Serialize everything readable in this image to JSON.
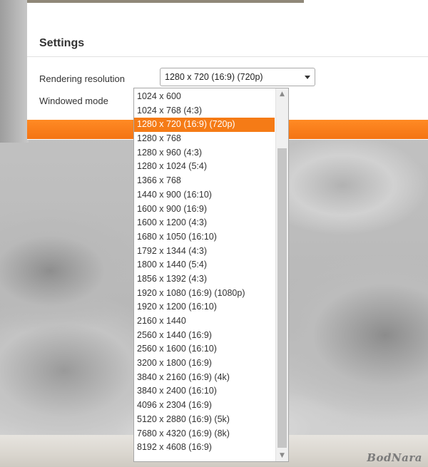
{
  "settings": {
    "title": "Settings",
    "rendering_resolution_label": "Rendering resolution",
    "windowed_mode_label": "Windowed mode",
    "selected_resolution": "1280 x 720 (16:9) (720p)"
  },
  "dropdown": {
    "options": [
      "1024 x 600",
      "1024 x 768 (4:3)",
      "1280 x 720 (16:9) (720p)",
      "1280 x 768",
      "1280 x 960 (4:3)",
      "1280 x 1024 (5:4)",
      "1366 x 768",
      "1440 x 900 (16:10)",
      "1600 x 900 (16:9)",
      "1600 x 1200 (4:3)",
      "1680 x 1050 (16:10)",
      "1792 x 1344 (4:3)",
      "1800 x 1440 (5:4)",
      "1856 x 1392 (4:3)",
      "1920 x 1080 (16:9) (1080p)",
      "1920 x 1200 (16:10)",
      "2160 x 1440",
      "2560 x 1440 (16:9)",
      "2560 x 1600 (16:10)",
      "3200 x 1800 (16:9)",
      "3840 x 2160 (16:9) (4k)",
      "3840 x 2400 (16:10)",
      "4096 x 2304 (16:9)",
      "5120 x 2880 (16:9) (5k)",
      "7680 x 4320 (16:9) (8k)",
      "8192 x 4608 (16:9)"
    ],
    "selected_index": 2,
    "scroll_up_icon": "chevron-up-icon",
    "scroll_down_icon": "chevron-down-icon"
  },
  "colors": {
    "accent": "#f57b16"
  },
  "watermark": "BodNara"
}
